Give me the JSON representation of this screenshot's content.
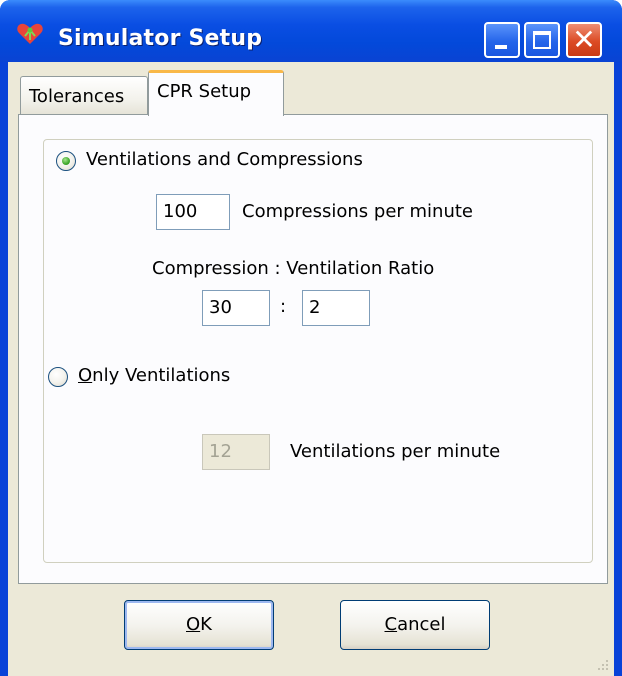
{
  "window": {
    "title": "Simulator Setup",
    "icon": "heart-app-icon"
  },
  "tabs": [
    {
      "label": "Tolerances",
      "active": false
    },
    {
      "label": "CPR Setup",
      "active": true
    }
  ],
  "cpr_setup": {
    "mode_ventilations_compressions": {
      "label": "Ventilations and Compressions",
      "selected": true
    },
    "compressions_per_minute": {
      "value": "100",
      "label": "Compressions per minute"
    },
    "ratio": {
      "heading": "Compression : Ventilation Ratio",
      "compression_value": "30",
      "separator": ":",
      "ventilation_value": "2"
    },
    "mode_only_ventilations": {
      "label_mnemonic": "O",
      "label_rest": "nly Ventilations",
      "selected": false
    },
    "ventilations_per_minute": {
      "value": "12",
      "label": "Ventilations per minute",
      "disabled": true
    }
  },
  "buttons": {
    "ok_mnemonic": "O",
    "ok_rest": "K",
    "cancel_mnemonic": "C",
    "cancel_rest": "ancel"
  },
  "colors": {
    "titlebar": "#0a4ee3",
    "close_button": "#dc4b24",
    "dialog_face": "#ece9d8",
    "active_tab_highlight": "#f9b848",
    "radio_dot": "#3ea82b"
  }
}
